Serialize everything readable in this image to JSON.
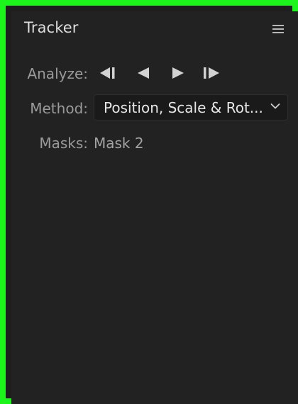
{
  "panel": {
    "title": "Tracker",
    "menu_icon": "hamburger-menu-icon"
  },
  "analyze": {
    "label": "Analyze:",
    "buttons": [
      {
        "name": "track-selected-backward-one-frame",
        "icon": "step-backward-icon"
      },
      {
        "name": "track-selected-backward",
        "icon": "play-backward-icon"
      },
      {
        "name": "track-selected-forward",
        "icon": "play-forward-icon"
      },
      {
        "name": "track-selected-forward-one-frame",
        "icon": "step-forward-icon"
      }
    ]
  },
  "method": {
    "label": "Method:",
    "selected": "Position, Scale & Rot...",
    "icon": "chevron-down-icon"
  },
  "masks": {
    "label": "Masks:",
    "value": "Mask 2"
  },
  "colors": {
    "frame_border": "#1cf51c",
    "panel_bg": "#222222",
    "label_text": "#9a9a9a",
    "value_text": "#e6e6e6"
  }
}
